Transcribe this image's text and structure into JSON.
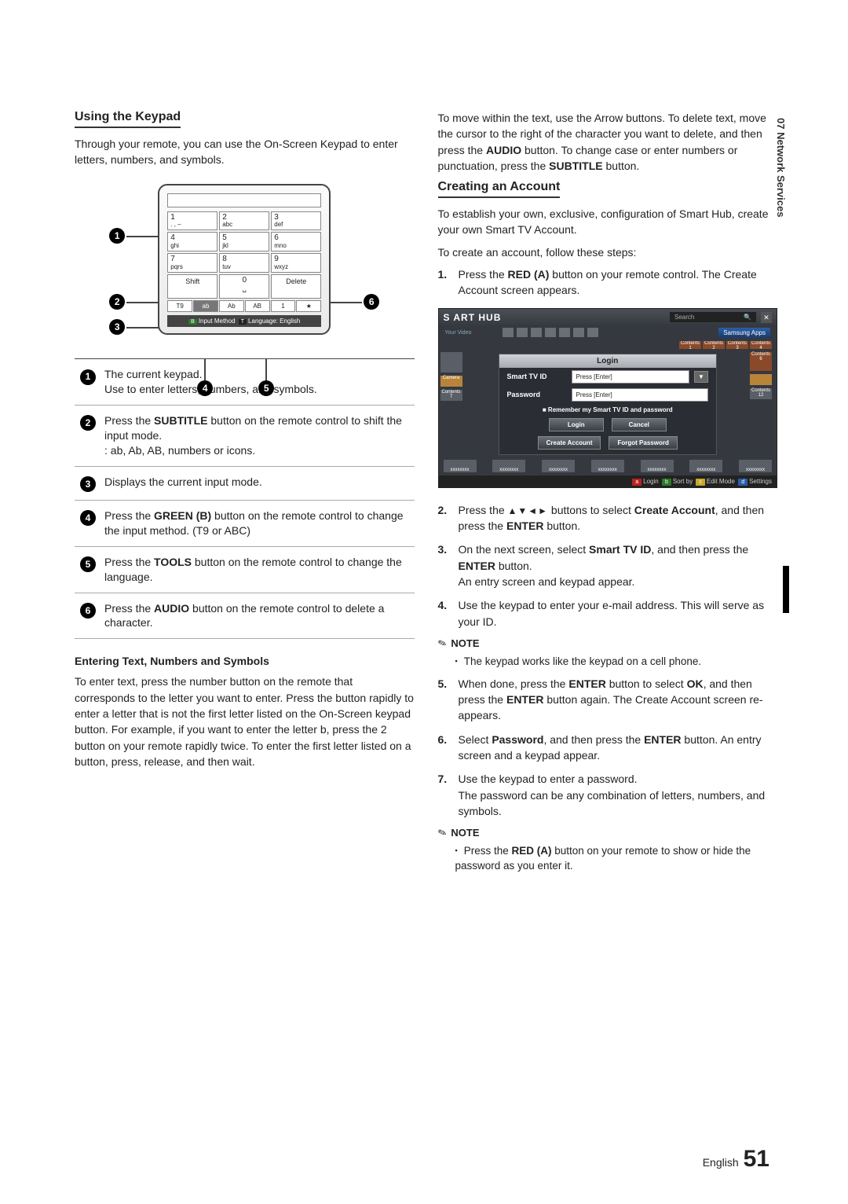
{
  "section_tab": "07  Network Services",
  "footer": {
    "lang": "English",
    "page": "51"
  },
  "left": {
    "heading1": "Using the Keypad",
    "intro": "Through your remote, you can use the On-Screen Keypad to enter letters, numbers, and symbols.",
    "keypad": {
      "keys": [
        {
          "n": "1",
          "t": ". , –"
        },
        {
          "n": "2",
          "t": "abc"
        },
        {
          "n": "3",
          "t": "def"
        },
        {
          "n": "4",
          "t": "ghi"
        },
        {
          "n": "5",
          "t": "jkl"
        },
        {
          "n": "6",
          "t": "mno"
        },
        {
          "n": "7",
          "t": "pqrs"
        },
        {
          "n": "8",
          "t": "tuv"
        },
        {
          "n": "9",
          "t": "wxyz"
        }
      ],
      "shift": "Shift",
      "zero": "0",
      "space": "␣",
      "delete": "Delete",
      "t9": "T9",
      "modes": [
        "ab",
        "Ab",
        "AB",
        "1",
        "★"
      ],
      "footer_b": "B",
      "footer_input": "Input Method",
      "footer_t": "T",
      "footer_lang": "Language: English"
    },
    "callout_labels": {
      "c4": "4",
      "c5": "5"
    },
    "legend": [
      {
        "n": "1",
        "text": "The current keypad.\nUse to enter letters, numbers, and symbols."
      },
      {
        "n": "2",
        "text_pre": "Press the ",
        "bold1": "SUBTITLE",
        "text_mid": " button on the remote control to shift the input mode.\n: ab, Ab, AB, numbers or icons."
      },
      {
        "n": "3",
        "text": "Displays the current input mode."
      },
      {
        "n": "4",
        "text_pre": "Press the ",
        "bold1": "GREEN (B)",
        "text_mid": " button on the remote control to change the input method. (T9 or ABC)"
      },
      {
        "n": "5",
        "text_pre": "Press the ",
        "bold1": "TOOLS",
        "text_mid": " button on the remote control to change the language."
      },
      {
        "n": "6",
        "text_pre": "Press the ",
        "bold1": "AUDIO",
        "text_mid": " button on the remote control to delete a character."
      }
    ],
    "sub2": "Entering Text, Numbers and Symbols",
    "para2": "To enter text, press the number button on the remote that corresponds to the letter you want to enter. Press the button rapidly to enter a letter that is not the first letter listed on the On-Screen keypad button. For example, if you want to enter the letter b, press the 2 button on your remote rapidly twice. To enter the first letter listed on a button, press, release, and then wait."
  },
  "right": {
    "para_top_a": "To move within the text, use the Arrow buttons. To delete text, move the cursor to the right of the character you want to delete, and then press the ",
    "bold_audio": "AUDIO",
    "para_top_b": " button. To change case or enter numbers or punctuation, press the ",
    "bold_subtitle": "SUBTITLE",
    "para_top_c": " button.",
    "heading2": "Creating an Account",
    "intro2": "To establish your own, exclusive, configuration of Smart Hub, create your own Smart TV Account.",
    "intro3": "To create an account, follow these steps:",
    "step1_a": "Press the ",
    "step1_bold": "RED (A)",
    "step1_b": " button on your remote control. The Create Account screen appears.",
    "hub": {
      "logo": "S   ART HUB",
      "search": "Search",
      "search_icon": "🔍",
      "your_video": "Your Video",
      "samsung_apps": "Samsung Apps",
      "contents": [
        "Contents 1",
        "Contents 2",
        "Contents 3",
        "Contents 4"
      ],
      "login_title": "Login",
      "id_label": "Smart TV ID",
      "id_placeholder": "Press [Enter]",
      "pw_label": "Password",
      "pw_placeholder": "Press [Enter]",
      "remember": "Remember my Smart TV ID and password",
      "login_btn": "Login",
      "cancel_btn": "Cancel",
      "create_btn": "Create Account",
      "forgot_btn": "Forgot Password",
      "sidebar": [
        "Camera",
        "Contents 7"
      ],
      "right_sidebar": [
        "Contents 6",
        "Contents 12"
      ],
      "thumbs": [
        "xxxxxxxx",
        "xxxxxxxx",
        "xxxxxxxx",
        "xxxxxxxx",
        "xxxxxxxx",
        "xxxxxxxx",
        "xxxxxxxx"
      ],
      "bar_a": "a Login",
      "bar_b": "b Sort by",
      "bar_c": "c Edit Mode",
      "bar_d": "d Settings"
    },
    "step2_a": "Press the ",
    "step2_arrows": "▲▼◄►",
    "step2_b": " buttons to select ",
    "step2_bold": "Create Account",
    "step2_c": ", and then press the ",
    "step2_bold2": "ENTER",
    "step2_d": " button.",
    "step3_a": "On the next screen, select ",
    "step3_bold": "Smart TV ID",
    "step3_b": ", and then press the ",
    "step3_bold2": "ENTER",
    "step3_c": " button.\nAn entry screen and keypad appear.",
    "step4": "Use the keypad to enter your e-mail address. This will serve as your ID.",
    "note1": "NOTE",
    "note1_item": "The keypad works like the keypad on a cell phone.",
    "step5_a": "When done, press the ",
    "step5_bold": "ENTER",
    "step5_b": " button to select ",
    "step5_bold2": "OK",
    "step5_c": ", and then press the ",
    "step5_bold3": "ENTER",
    "step5_d": " button again. The Create Account screen re-appears.",
    "step6_a": "Select ",
    "step6_bold": "Password",
    "step6_b": ", and then press the ",
    "step6_bold2": "ENTER",
    "step6_c": " button. An entry screen and a keypad appear.",
    "step7": "Use the keypad to enter a password.\nThe password can be any combination of letters, numbers, and symbols.",
    "note2": "NOTE",
    "note2_item_a": "Press the ",
    "note2_item_bold": "RED (A)",
    "note2_item_b": " button on your remote to show or hide the password as you enter it."
  }
}
